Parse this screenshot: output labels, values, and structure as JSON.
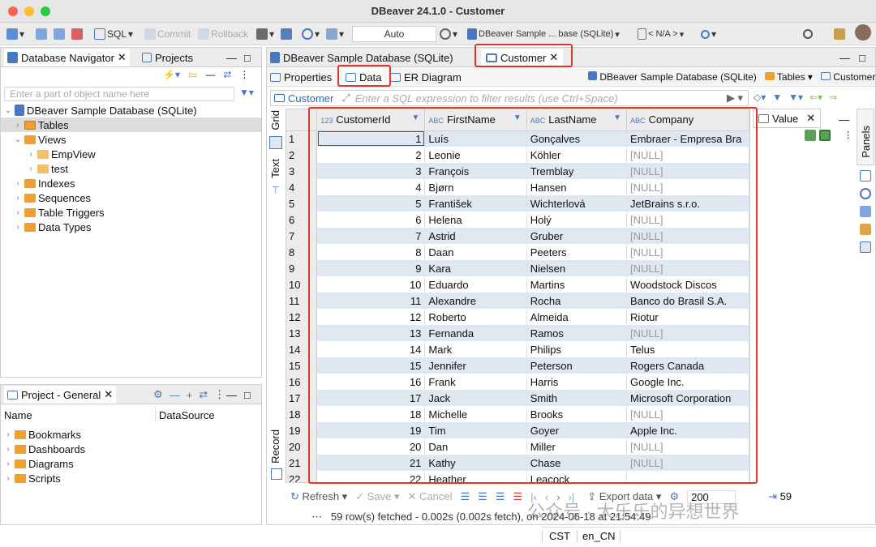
{
  "window": {
    "title": "DBeaver 24.1.0 - Customer"
  },
  "toolbar": {
    "sql": "SQL",
    "commit": "Commit",
    "rollback": "Rollback",
    "auto": "Auto",
    "datasource": "DBeaver Sample ... base (SQLite)",
    "schema": "< N/A >"
  },
  "navigator": {
    "tab1": "Database Navigator",
    "tab2": "Projects",
    "filter_placeholder": "Enter a part of object name here",
    "items": [
      {
        "label": "DBeaver Sample Database (SQLite)"
      },
      {
        "label": "Tables"
      },
      {
        "label": "Views"
      },
      {
        "label": "EmpView"
      },
      {
        "label": "test"
      },
      {
        "label": "Indexes"
      },
      {
        "label": "Sequences"
      },
      {
        "label": "Table Triggers"
      },
      {
        "label": "Data Types"
      }
    ]
  },
  "project": {
    "tab": "Project - General",
    "col_name": "Name",
    "col_ds": "DataSource",
    "items": [
      "Bookmarks",
      "Dashboards",
      "Diagrams",
      "Scripts"
    ]
  },
  "editor": {
    "tab1": "DBeaver Sample Database (SQLite)",
    "tab2": "Customer",
    "subtabs": [
      "Properties",
      "Data",
      "ER Diagram"
    ],
    "crumb_ds": "DBeaver Sample Database (SQLite)",
    "crumb_tables": "Tables",
    "crumb_obj": "Customer"
  },
  "filter": {
    "label": "Customer",
    "placeholder": "Enter a SQL expression to filter results (use Ctrl+Space)"
  },
  "side": {
    "grid": "Grid",
    "text": "Text",
    "record": "Record",
    "value": "Value",
    "panels": "Panels"
  },
  "grid": {
    "columns": [
      "CustomerId",
      "FirstName",
      "LastName",
      "Company"
    ],
    "rows": [
      [
        "1",
        "1",
        "Luís",
        "Gonçalves",
        "Embraer - Empresa Bra"
      ],
      [
        "2",
        "2",
        "Leonie",
        "Köhler",
        "[NULL]"
      ],
      [
        "3",
        "3",
        "François",
        "Tremblay",
        "[NULL]"
      ],
      [
        "4",
        "4",
        "Bjørn",
        "Hansen",
        "[NULL]"
      ],
      [
        "5",
        "5",
        "František",
        "Wichterlová",
        "JetBrains s.r.o."
      ],
      [
        "6",
        "6",
        "Helena",
        "Holý",
        "[NULL]"
      ],
      [
        "7",
        "7",
        "Astrid",
        "Gruber",
        "[NULL]"
      ],
      [
        "8",
        "8",
        "Daan",
        "Peeters",
        "[NULL]"
      ],
      [
        "9",
        "9",
        "Kara",
        "Nielsen",
        "[NULL]"
      ],
      [
        "10",
        "10",
        "Eduardo",
        "Martins",
        "Woodstock Discos"
      ],
      [
        "11",
        "11",
        "Alexandre",
        "Rocha",
        "Banco do Brasil S.A."
      ],
      [
        "12",
        "12",
        "Roberto",
        "Almeida",
        "Riotur"
      ],
      [
        "13",
        "13",
        "Fernanda",
        "Ramos",
        "[NULL]"
      ],
      [
        "14",
        "14",
        "Mark",
        "Philips",
        "Telus"
      ],
      [
        "15",
        "15",
        "Jennifer",
        "Peterson",
        "Rogers Canada"
      ],
      [
        "16",
        "16",
        "Frank",
        "Harris",
        "Google Inc."
      ],
      [
        "17",
        "17",
        "Jack",
        "Smith",
        "Microsoft Corporation"
      ],
      [
        "18",
        "18",
        "Michelle",
        "Brooks",
        "[NULL]"
      ],
      [
        "19",
        "19",
        "Tim",
        "Goyer",
        "Apple Inc."
      ],
      [
        "20",
        "20",
        "Dan",
        "Miller",
        "[NULL]"
      ],
      [
        "21",
        "21",
        "Kathy",
        "Chase",
        "[NULL]"
      ],
      [
        "22",
        "22",
        "Heather",
        "Leacock",
        ""
      ]
    ]
  },
  "bottom": {
    "refresh": "Refresh",
    "save": "Save",
    "cancel": "Cancel",
    "export": "Export data",
    "fetch_size": "200",
    "count": "59",
    "status": "59 row(s) fetched - 0.002s (0.002s fetch), on 2024-06-18 at 21:54:49"
  },
  "statusbar": {
    "tz": "CST",
    "locale": "en_CN"
  },
  "watermark": "公众号 · 大乐乐的异想世界"
}
